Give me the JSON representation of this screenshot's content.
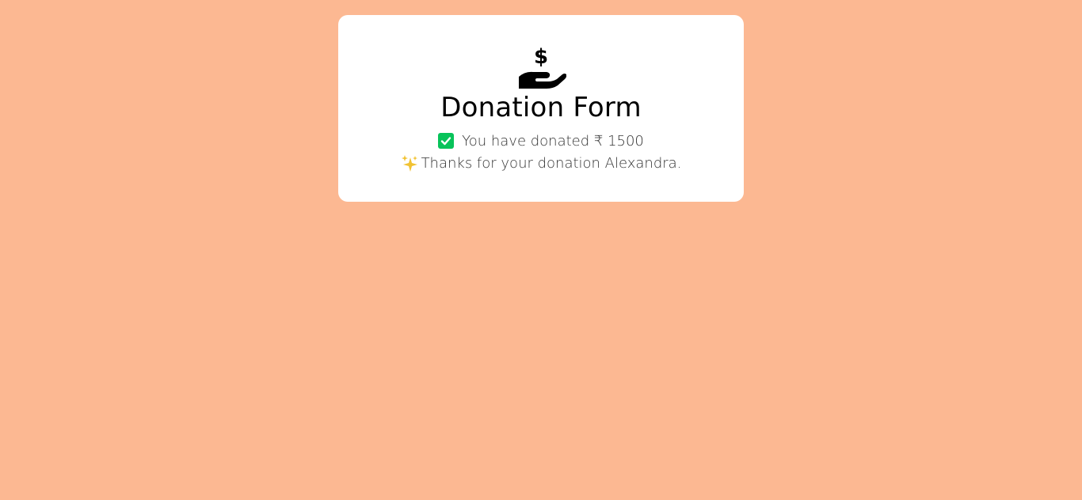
{
  "form": {
    "title": "Donation Form",
    "status_text": "You have donated ₹ 1500",
    "thanks_text": "Thanks for your donation Alexandra."
  },
  "icons": {
    "logo": "hand-holding-dollar-icon",
    "status": "check-square-icon",
    "thanks": "sparkles-icon"
  },
  "colors": {
    "background": "#fcb892",
    "card": "#ffffff",
    "check": "#08c35a",
    "sparkle": "#f1c232"
  }
}
